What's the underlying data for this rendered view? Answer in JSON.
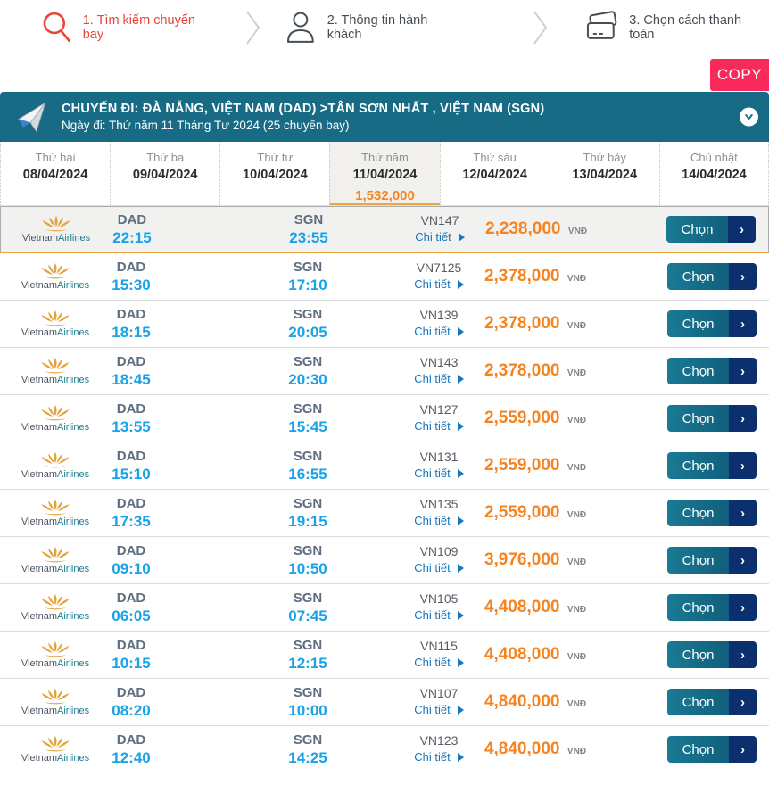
{
  "steps": [
    {
      "label": "1. Tìm kiếm chuyến bay",
      "icon": "search-icon",
      "active": true
    },
    {
      "label": "2. Thông tin hành khách",
      "icon": "person-icon",
      "active": false
    },
    {
      "label": "3. Chọn cách thanh toán",
      "icon": "card-icon",
      "active": false
    }
  ],
  "copy_button": "COPY",
  "trip_header": {
    "title": "CHUYẾN ĐI: ĐÀ NẴNG, VIỆT NAM (DAD) >TÂN SƠN NHẤT , VIỆT NAM (SGN)",
    "subtitle": "Ngày đi: Thứ năm 11 Tháng Tư 2024 (25 chuyến bay)"
  },
  "day_tabs": [
    {
      "day": "Thứ hai",
      "date": "08/04/2024"
    },
    {
      "day": "Thứ ba",
      "date": "09/04/2024"
    },
    {
      "day": "Thứ tư",
      "date": "10/04/2024"
    },
    {
      "day": "Thứ năm",
      "date": "11/04/2024",
      "price": "1,532,000",
      "selected": true
    },
    {
      "day": "Thứ sáu",
      "date": "12/04/2024"
    },
    {
      "day": "Thứ bảy",
      "date": "13/04/2024"
    },
    {
      "day": "Chủ nhật",
      "date": "14/04/2024"
    }
  ],
  "airline": {
    "name_part1": "Vietnam",
    "name_part2": "Airlines"
  },
  "row_labels": {
    "detail": "Chi tiết",
    "select": "Chọn",
    "select_arrow": "›",
    "currency": "VNĐ"
  },
  "flights": [
    {
      "dep_code": "DAD",
      "dep_time": "22:15",
      "arr_code": "SGN",
      "arr_time": "23:55",
      "flight_no": "VN147",
      "price": "2,238,000",
      "highlighted": true
    },
    {
      "dep_code": "DAD",
      "dep_time": "15:30",
      "arr_code": "SGN",
      "arr_time": "17:10",
      "flight_no": "VN7125",
      "price": "2,378,000"
    },
    {
      "dep_code": "DAD",
      "dep_time": "18:15",
      "arr_code": "SGN",
      "arr_time": "20:05",
      "flight_no": "VN139",
      "price": "2,378,000"
    },
    {
      "dep_code": "DAD",
      "dep_time": "18:45",
      "arr_code": "SGN",
      "arr_time": "20:30",
      "flight_no": "VN143",
      "price": "2,378,000"
    },
    {
      "dep_code": "DAD",
      "dep_time": "13:55",
      "arr_code": "SGN",
      "arr_time": "15:45",
      "flight_no": "VN127",
      "price": "2,559,000"
    },
    {
      "dep_code": "DAD",
      "dep_time": "15:10",
      "arr_code": "SGN",
      "arr_time": "16:55",
      "flight_no": "VN131",
      "price": "2,559,000"
    },
    {
      "dep_code": "DAD",
      "dep_time": "17:35",
      "arr_code": "SGN",
      "arr_time": "19:15",
      "flight_no": "VN135",
      "price": "2,559,000"
    },
    {
      "dep_code": "DAD",
      "dep_time": "09:10",
      "arr_code": "SGN",
      "arr_time": "10:50",
      "flight_no": "VN109",
      "price": "3,976,000"
    },
    {
      "dep_code": "DAD",
      "dep_time": "06:05",
      "arr_code": "SGN",
      "arr_time": "07:45",
      "flight_no": "VN105",
      "price": "4,408,000"
    },
    {
      "dep_code": "DAD",
      "dep_time": "10:15",
      "arr_code": "SGN",
      "arr_time": "12:15",
      "flight_no": "VN115",
      "price": "4,408,000"
    },
    {
      "dep_code": "DAD",
      "dep_time": "08:20",
      "arr_code": "SGN",
      "arr_time": "10:00",
      "flight_no": "VN107",
      "price": "4,840,000"
    },
    {
      "dep_code": "DAD",
      "dep_time": "12:40",
      "arr_code": "SGN",
      "arr_time": "14:25",
      "flight_no": "VN123",
      "price": "4,840,000"
    }
  ],
  "colors": {
    "accent_orange": "#F6831F",
    "step_active_red": "#EC4436",
    "copy_pink": "#F82A5C",
    "header_teal": "#186B84",
    "time_blue": "#17A2E9",
    "button_navy": "#0C2F6D",
    "logo_gold": "#E2A23A",
    "selected_tab_bg": "#F1F0EC",
    "tab_underline": "#ECA53C"
  }
}
